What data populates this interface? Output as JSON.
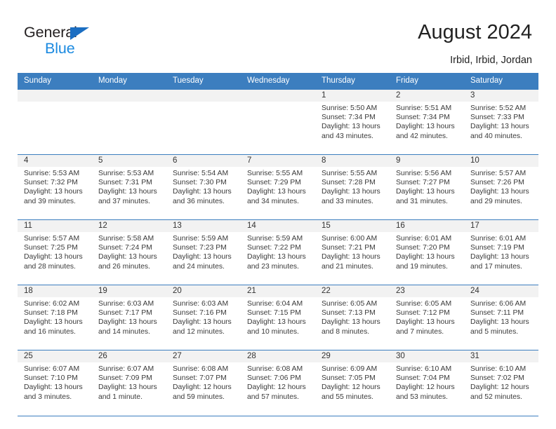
{
  "brand": {
    "line1": "General",
    "line2": "Blue",
    "triangle_color": "#1b6ec2",
    "line2_color": "#1b8ae0"
  },
  "header": {
    "title": "August 2024",
    "subtitle": "Irbid, Irbid, Jordan",
    "accent_color": "#3c7ebf"
  },
  "calendar": {
    "weekday_headers": [
      "Sunday",
      "Monday",
      "Tuesday",
      "Wednesday",
      "Thursday",
      "Friday",
      "Saturday"
    ],
    "labels": {
      "sunrise": "Sunrise:",
      "sunset": "Sunset:",
      "daylight": "Daylight:"
    },
    "weeks": [
      [
        {
          "day": "",
          "sunrise": "",
          "sunset": "",
          "daylight_line1": "",
          "daylight_line2": ""
        },
        {
          "day": "",
          "sunrise": "",
          "sunset": "",
          "daylight_line1": "",
          "daylight_line2": ""
        },
        {
          "day": "",
          "sunrise": "",
          "sunset": "",
          "daylight_line1": "",
          "daylight_line2": ""
        },
        {
          "day": "",
          "sunrise": "",
          "sunset": "",
          "daylight_line1": "",
          "daylight_line2": ""
        },
        {
          "day": "1",
          "sunrise": "Sunrise: 5:50 AM",
          "sunset": "Sunset: 7:34 PM",
          "daylight_line1": "Daylight: 13 hours",
          "daylight_line2": "and 43 minutes."
        },
        {
          "day": "2",
          "sunrise": "Sunrise: 5:51 AM",
          "sunset": "Sunset: 7:34 PM",
          "daylight_line1": "Daylight: 13 hours",
          "daylight_line2": "and 42 minutes."
        },
        {
          "day": "3",
          "sunrise": "Sunrise: 5:52 AM",
          "sunset": "Sunset: 7:33 PM",
          "daylight_line1": "Daylight: 13 hours",
          "daylight_line2": "and 40 minutes."
        }
      ],
      [
        {
          "day": "4",
          "sunrise": "Sunrise: 5:53 AM",
          "sunset": "Sunset: 7:32 PM",
          "daylight_line1": "Daylight: 13 hours",
          "daylight_line2": "and 39 minutes."
        },
        {
          "day": "5",
          "sunrise": "Sunrise: 5:53 AM",
          "sunset": "Sunset: 7:31 PM",
          "daylight_line1": "Daylight: 13 hours",
          "daylight_line2": "and 37 minutes."
        },
        {
          "day": "6",
          "sunrise": "Sunrise: 5:54 AM",
          "sunset": "Sunset: 7:30 PM",
          "daylight_line1": "Daylight: 13 hours",
          "daylight_line2": "and 36 minutes."
        },
        {
          "day": "7",
          "sunrise": "Sunrise: 5:55 AM",
          "sunset": "Sunset: 7:29 PM",
          "daylight_line1": "Daylight: 13 hours",
          "daylight_line2": "and 34 minutes."
        },
        {
          "day": "8",
          "sunrise": "Sunrise: 5:55 AM",
          "sunset": "Sunset: 7:28 PM",
          "daylight_line1": "Daylight: 13 hours",
          "daylight_line2": "and 33 minutes."
        },
        {
          "day": "9",
          "sunrise": "Sunrise: 5:56 AM",
          "sunset": "Sunset: 7:27 PM",
          "daylight_line1": "Daylight: 13 hours",
          "daylight_line2": "and 31 minutes."
        },
        {
          "day": "10",
          "sunrise": "Sunrise: 5:57 AM",
          "sunset": "Sunset: 7:26 PM",
          "daylight_line1": "Daylight: 13 hours",
          "daylight_line2": "and 29 minutes."
        }
      ],
      [
        {
          "day": "11",
          "sunrise": "Sunrise: 5:57 AM",
          "sunset": "Sunset: 7:25 PM",
          "daylight_line1": "Daylight: 13 hours",
          "daylight_line2": "and 28 minutes."
        },
        {
          "day": "12",
          "sunrise": "Sunrise: 5:58 AM",
          "sunset": "Sunset: 7:24 PM",
          "daylight_line1": "Daylight: 13 hours",
          "daylight_line2": "and 26 minutes."
        },
        {
          "day": "13",
          "sunrise": "Sunrise: 5:59 AM",
          "sunset": "Sunset: 7:23 PM",
          "daylight_line1": "Daylight: 13 hours",
          "daylight_line2": "and 24 minutes."
        },
        {
          "day": "14",
          "sunrise": "Sunrise: 5:59 AM",
          "sunset": "Sunset: 7:22 PM",
          "daylight_line1": "Daylight: 13 hours",
          "daylight_line2": "and 23 minutes."
        },
        {
          "day": "15",
          "sunrise": "Sunrise: 6:00 AM",
          "sunset": "Sunset: 7:21 PM",
          "daylight_line1": "Daylight: 13 hours",
          "daylight_line2": "and 21 minutes."
        },
        {
          "day": "16",
          "sunrise": "Sunrise: 6:01 AM",
          "sunset": "Sunset: 7:20 PM",
          "daylight_line1": "Daylight: 13 hours",
          "daylight_line2": "and 19 minutes."
        },
        {
          "day": "17",
          "sunrise": "Sunrise: 6:01 AM",
          "sunset": "Sunset: 7:19 PM",
          "daylight_line1": "Daylight: 13 hours",
          "daylight_line2": "and 17 minutes."
        }
      ],
      [
        {
          "day": "18",
          "sunrise": "Sunrise: 6:02 AM",
          "sunset": "Sunset: 7:18 PM",
          "daylight_line1": "Daylight: 13 hours",
          "daylight_line2": "and 16 minutes."
        },
        {
          "day": "19",
          "sunrise": "Sunrise: 6:03 AM",
          "sunset": "Sunset: 7:17 PM",
          "daylight_line1": "Daylight: 13 hours",
          "daylight_line2": "and 14 minutes."
        },
        {
          "day": "20",
          "sunrise": "Sunrise: 6:03 AM",
          "sunset": "Sunset: 7:16 PM",
          "daylight_line1": "Daylight: 13 hours",
          "daylight_line2": "and 12 minutes."
        },
        {
          "day": "21",
          "sunrise": "Sunrise: 6:04 AM",
          "sunset": "Sunset: 7:15 PM",
          "daylight_line1": "Daylight: 13 hours",
          "daylight_line2": "and 10 minutes."
        },
        {
          "day": "22",
          "sunrise": "Sunrise: 6:05 AM",
          "sunset": "Sunset: 7:13 PM",
          "daylight_line1": "Daylight: 13 hours",
          "daylight_line2": "and 8 minutes."
        },
        {
          "day": "23",
          "sunrise": "Sunrise: 6:05 AM",
          "sunset": "Sunset: 7:12 PM",
          "daylight_line1": "Daylight: 13 hours",
          "daylight_line2": "and 7 minutes."
        },
        {
          "day": "24",
          "sunrise": "Sunrise: 6:06 AM",
          "sunset": "Sunset: 7:11 PM",
          "daylight_line1": "Daylight: 13 hours",
          "daylight_line2": "and 5 minutes."
        }
      ],
      [
        {
          "day": "25",
          "sunrise": "Sunrise: 6:07 AM",
          "sunset": "Sunset: 7:10 PM",
          "daylight_line1": "Daylight: 13 hours",
          "daylight_line2": "and 3 minutes."
        },
        {
          "day": "26",
          "sunrise": "Sunrise: 6:07 AM",
          "sunset": "Sunset: 7:09 PM",
          "daylight_line1": "Daylight: 13 hours",
          "daylight_line2": "and 1 minute."
        },
        {
          "day": "27",
          "sunrise": "Sunrise: 6:08 AM",
          "sunset": "Sunset: 7:07 PM",
          "daylight_line1": "Daylight: 12 hours",
          "daylight_line2": "and 59 minutes."
        },
        {
          "day": "28",
          "sunrise": "Sunrise: 6:08 AM",
          "sunset": "Sunset: 7:06 PM",
          "daylight_line1": "Daylight: 12 hours",
          "daylight_line2": "and 57 minutes."
        },
        {
          "day": "29",
          "sunrise": "Sunrise: 6:09 AM",
          "sunset": "Sunset: 7:05 PM",
          "daylight_line1": "Daylight: 12 hours",
          "daylight_line2": "and 55 minutes."
        },
        {
          "day": "30",
          "sunrise": "Sunrise: 6:10 AM",
          "sunset": "Sunset: 7:04 PM",
          "daylight_line1": "Daylight: 12 hours",
          "daylight_line2": "and 53 minutes."
        },
        {
          "day": "31",
          "sunrise": "Sunrise: 6:10 AM",
          "sunset": "Sunset: 7:02 PM",
          "daylight_line1": "Daylight: 12 hours",
          "daylight_line2": "and 52 minutes."
        }
      ]
    ]
  }
}
